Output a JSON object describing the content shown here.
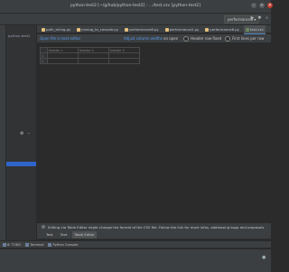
{
  "window": {
    "title": "python-test2 [~/g/hub/python-test2] - .../test.csv [python-test2]"
  },
  "toolbar": {
    "project_dropdown": "performance8 ▾",
    "icons": [
      "run-icon",
      "debug-icon",
      "search-icon"
    ]
  },
  "sidebar": {
    "project_label": "python-test2"
  },
  "editor_tabs": [
    {
      "label": "path_string.py",
      "active": false
    },
    {
      "label": "jmvlog_to_console.py",
      "active": false
    },
    {
      "label": "performance6.py",
      "active": false
    },
    {
      "label": "performance2.py",
      "active": false
    },
    {
      "label": "performance8.py",
      "active": false
    },
    {
      "label": "test.csv",
      "active": true
    }
  ],
  "csv_toolbar": {
    "open_label": "Open file in text editor",
    "adjust_label": "Adjust column widths",
    "on_open": "on open",
    "header_row": "Header row fixed",
    "first_col": "First lines per row"
  },
  "csv_table": {
    "headers": [
      "header 1",
      "header 2",
      "header 3"
    ],
    "rows": [
      [
        "1",
        "",
        "",
        ""
      ],
      [
        "2",
        "",
        "",
        ""
      ]
    ]
  },
  "info_bar": {
    "text": "Editing via Table Editor might change the format of the CSV file. Follow the link for more infos, addressing bugs and proposals"
  },
  "bottom_tabs": [
    {
      "label": "Text",
      "active": false
    },
    {
      "label": "Text",
      "active": false
    },
    {
      "label": "Table Editor",
      "active": true
    }
  ],
  "tool_windows": [
    {
      "label": "6: TODO"
    },
    {
      "label": "Terminal"
    },
    {
      "label": "Python Console"
    }
  ]
}
